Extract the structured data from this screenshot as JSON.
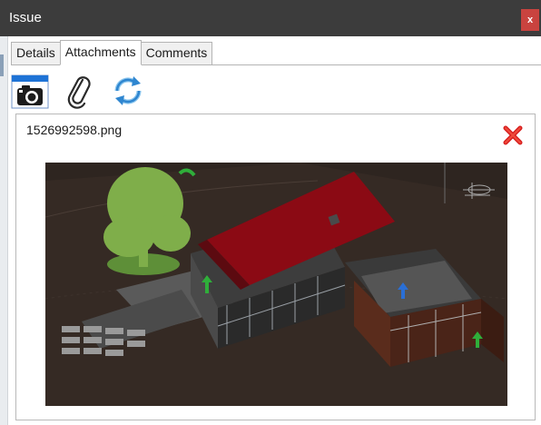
{
  "window": {
    "title": "Issue",
    "close_label": "x"
  },
  "tabs": [
    {
      "label": "Details",
      "active": false
    },
    {
      "label": "Attachments",
      "active": true
    },
    {
      "label": "Comments",
      "active": false
    }
  ],
  "toolbar": {
    "icons": [
      "camera-icon",
      "paperclip-icon",
      "refresh-icon"
    ]
  },
  "attachment": {
    "filename": "1526992598.png",
    "delete_icon": "red-x-icon"
  },
  "colors": {
    "titlebar": "#3c3c3c",
    "close": "#c9433f",
    "roof": "#8b0a14",
    "ground": "#2e2520",
    "tree": "#7fae4a"
  }
}
